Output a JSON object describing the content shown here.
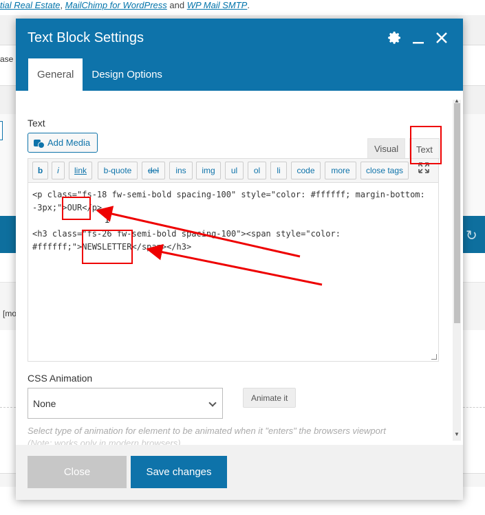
{
  "background": {
    "plugins_line": {
      "link1": "tial Real Estate",
      "sep1": ", ",
      "link2": "MailChimp for WordPress",
      "and": " and ",
      "link3": "WP Mail SMTP",
      "end": "."
    },
    "left_text_1": "ase",
    "left_text_2": "[mo"
  },
  "modal": {
    "title": "Text Block Settings",
    "tabs": [
      {
        "label": "General",
        "active": true
      },
      {
        "label": "Design Options",
        "active": false
      }
    ],
    "text_label": "Text",
    "add_media_label": "Add Media",
    "editor_tabs": {
      "visual": "Visual",
      "text": "Text"
    },
    "quicktags": [
      "b",
      "i",
      "link",
      "b-quote",
      "del",
      "ins",
      "img",
      "ul",
      "ol",
      "li",
      "code",
      "more",
      "close tags"
    ],
    "content_line1": "<p class=\"fs-18 fw-semi-bold spacing-100\" style=\"color: #ffffff; margin-bottom: -3px;\">OUR</p>",
    "content_line2": "",
    "content_line3": "<h3 class=\"fs-26 fw-semi-bold spacing-100\"><span style=\"color: #ffffff;\">NEWSLETTER</span></h3>",
    "css_animation_label": "CSS Animation",
    "css_animation_value": "None",
    "animate_button": "Animate it",
    "help_text": "Select type of animation for element to be animated when it \"enters\" the browsers viewport",
    "help_text_2": "(Note: works only in modern browsers).",
    "close_button": "Close",
    "save_button": "Save changes"
  },
  "colors": {
    "header_blue": "#0e73aa",
    "annotation_red": "#e00000"
  }
}
